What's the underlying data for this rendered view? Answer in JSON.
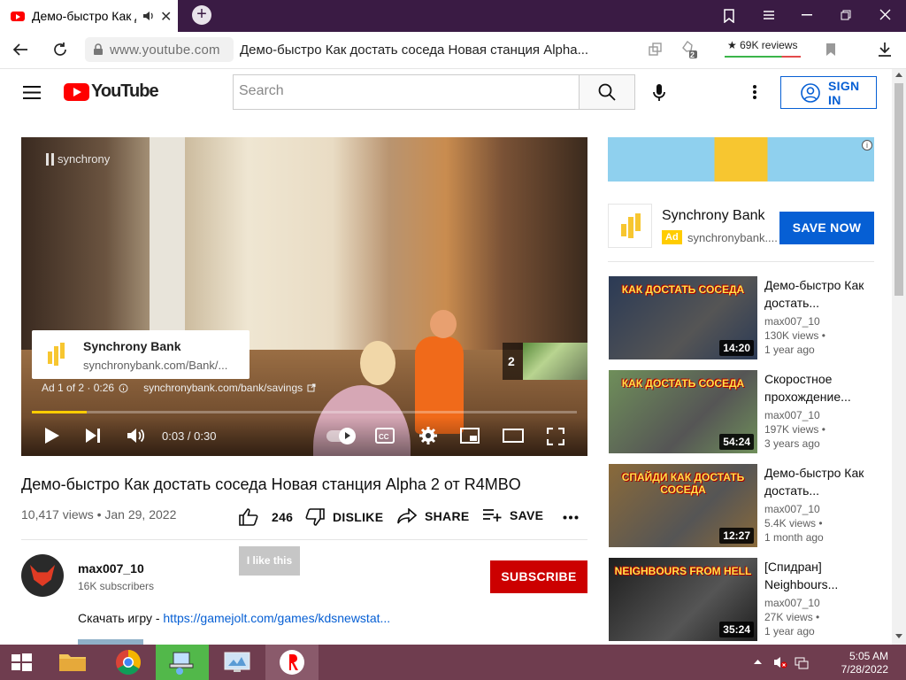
{
  "browser": {
    "tab_title": "Демо-быстро Как д",
    "url_host": "www.youtube.com",
    "page_title": "Демо-быстро Как достать соседа Новая станция Alpha...",
    "reviews_label": "★ 69K reviews",
    "ext_badge": "2"
  },
  "header": {
    "logo_text": "YouTube",
    "search_placeholder": "Search",
    "signin_label": "SIGN IN"
  },
  "player": {
    "watermark": "synchrony",
    "ad_title": "Synchrony Bank",
    "ad_url_short": "synchronybank.com/Bank/...",
    "ad_counter": "Ad 1 of 2 · 0:26",
    "ad_link": "synchronybank.com/bank/savings",
    "next_count": "2",
    "time": "0:03 / 0:30",
    "progress": 0.1
  },
  "video": {
    "title": "Демо-быстро Как достать соседа Новая станция Alpha 2 от R4MBO",
    "meta": "10,417 views • Jan 29, 2022",
    "likes": "246",
    "dislike_label": "DISLIKE",
    "share_label": "SHARE",
    "save_label": "SAVE",
    "tooltip": "I like this"
  },
  "channel": {
    "name": "max007_10",
    "subs": "16K subscribers",
    "subscribe_label": "SUBSCRIBE",
    "description_prefix": "Скачать игру - ",
    "description_link": "https://gamejolt.com/games/kdsnewstat..."
  },
  "sidebar_ad": {
    "name": "Synchrony Bank",
    "badge": "Ad",
    "domain": "synchronybank....",
    "cta": "SAVE NOW"
  },
  "recommendations": [
    {
      "title": "Демо-быстро Как достать...",
      "channel": "max007_10",
      "views": "130K views •",
      "age": "1 year ago",
      "duration": "14:20",
      "thumb_text": "КАК ДОСТАТЬ СОСЕДА",
      "thumb_color": "#2b3a55"
    },
    {
      "title": "Скоростное прохождение...",
      "channel": "max007_10",
      "views": "197K views •",
      "age": "3 years ago",
      "duration": "54:24",
      "thumb_text": "КАК ДОСТАТЬ СОСЕДА",
      "thumb_color": "#6f8f5a"
    },
    {
      "title": "Демо-быстро Как достать...",
      "channel": "max007_10",
      "views": "5.4K views •",
      "age": "1 month ago",
      "duration": "12:27",
      "thumb_text": "СПАЙДИ КАК ДОСТАТЬ СОСЕДА",
      "thumb_color": "#8a6a3a"
    },
    {
      "title": "[Спидран] Neighbours...",
      "channel": "max007_10",
      "views": "27K views •",
      "age": "1 year ago",
      "duration": "35:24",
      "thumb_text": "NEIGHBOURS FROM HELL",
      "thumb_color": "#1e1e1e"
    }
  ],
  "taskbar": {
    "time": "5:05 AM",
    "date": "7/28/2022"
  }
}
